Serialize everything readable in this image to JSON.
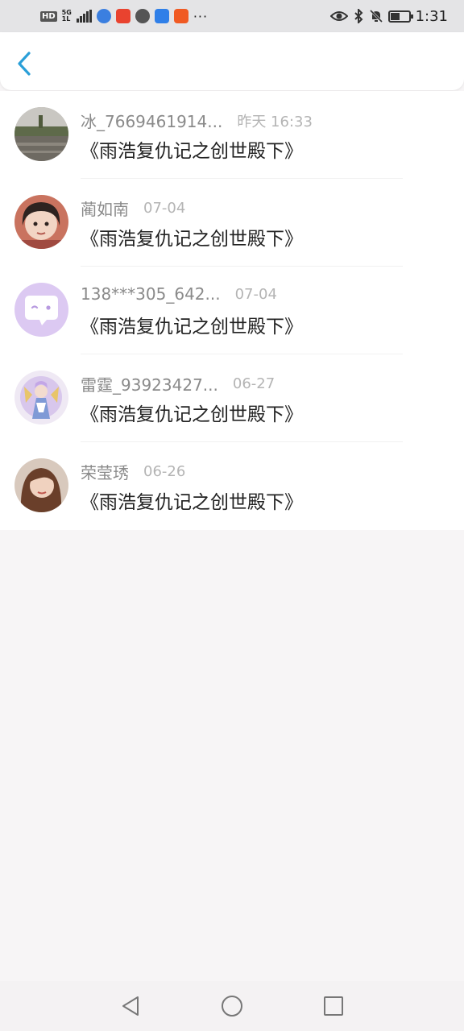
{
  "status_bar": {
    "hd": "HD",
    "network": "5G",
    "network_sub": "1L",
    "dots": "···",
    "time": "1:31"
  },
  "colors": {
    "accent": "#2a9fd8",
    "name": "#8a8a8a",
    "time": "#b4b4b4",
    "title": "#222222",
    "page_bg": "#f7f5f6"
  },
  "items": [
    {
      "name": "冰_7669461914...",
      "time": "昨天 16:33",
      "title": "《雨浩复仇记之创世殿下》",
      "avatar": "landscape-photo"
    },
    {
      "name": "蔺如南",
      "time": "07-04",
      "title": "《雨浩复仇记之创世殿下》",
      "avatar": "child-photo"
    },
    {
      "name": "138***305_642...",
      "time": "07-04",
      "title": "《雨浩复仇记之创世殿下》",
      "avatar": "default-chat-avatar"
    },
    {
      "name": "雷霆_93923427...",
      "time": "06-27",
      "title": "《雨浩复仇记之创世殿下》",
      "avatar": "anime-illustration"
    },
    {
      "name": "荣莹琇",
      "time": "06-26",
      "title": "《雨浩复仇记之创世殿下》",
      "avatar": "portrait-photo"
    }
  ]
}
